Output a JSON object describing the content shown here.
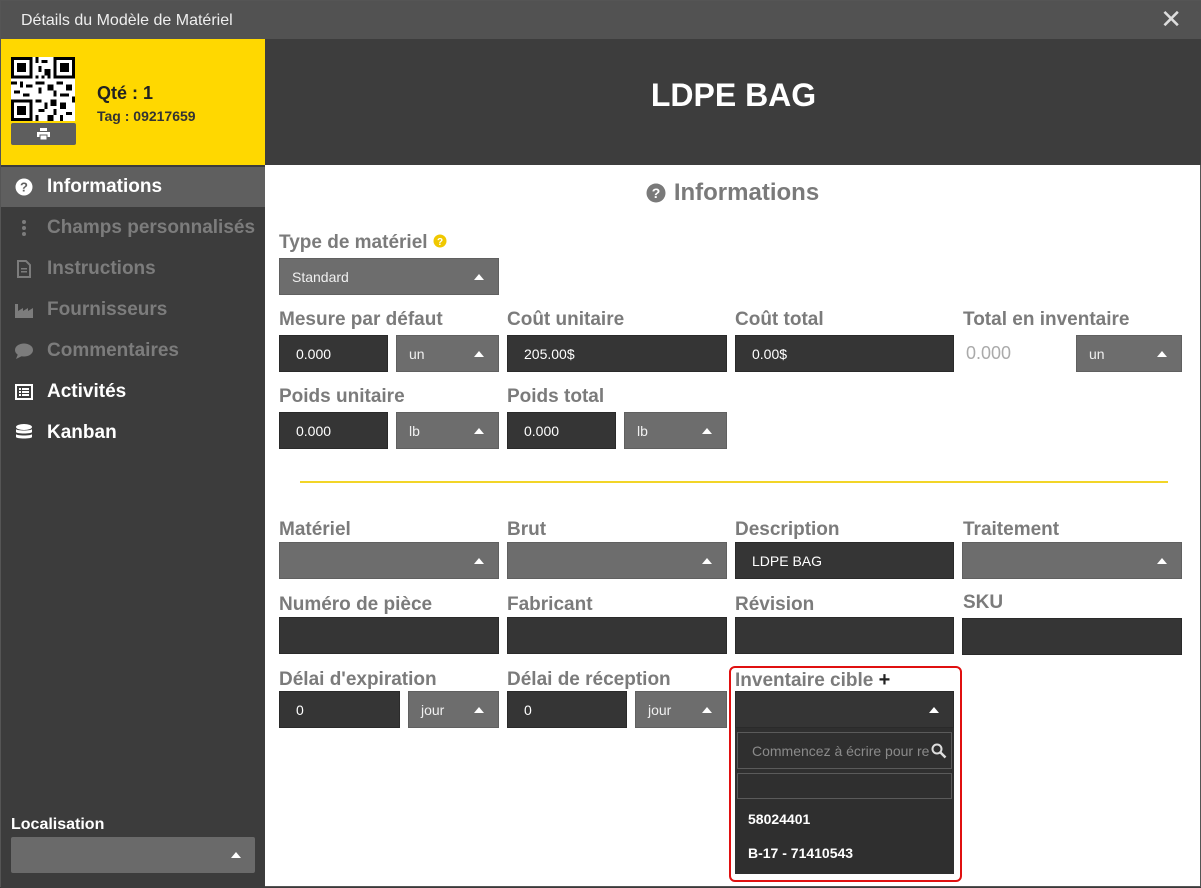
{
  "window": {
    "title": "Détails du Modèle de Matériel",
    "close_label": "✕"
  },
  "item": {
    "qty_text": "Qté : 1",
    "tag_text": "Tag : 09217659",
    "name": "LDPE BAG"
  },
  "sidebar": {
    "items": [
      {
        "label": "Informations",
        "icon": "question-circle-icon"
      },
      {
        "label": "Champs personnalisés",
        "icon": "vertical-ellipsis-icon"
      },
      {
        "label": "Instructions",
        "icon": "document-icon"
      },
      {
        "label": "Fournisseurs",
        "icon": "factory-icon"
      },
      {
        "label": "Commentaires",
        "icon": "comment-icon"
      },
      {
        "label": "Activités",
        "icon": "list-icon"
      },
      {
        "label": "Kanban",
        "icon": "database-icon"
      }
    ],
    "location_label": "Localisation",
    "location_value": ""
  },
  "section": {
    "title": "Informations"
  },
  "fields": {
    "material_type": {
      "label": "Type de matériel",
      "value": "Standard"
    },
    "default_measure": {
      "label": "Mesure par défaut",
      "value": "0.000",
      "unit": "un"
    },
    "unit_cost": {
      "label": "Coût unitaire",
      "value": "205.00$"
    },
    "total_cost": {
      "label": "Coût total",
      "value": "0.00$"
    },
    "total_inventory": {
      "label": "Total en inventaire",
      "value": "0.000",
      "unit": "un"
    },
    "unit_weight": {
      "label": "Poids unitaire",
      "value": "0.000",
      "unit": "lb"
    },
    "total_weight": {
      "label": "Poids total",
      "value": "0.000",
      "unit": "lb"
    },
    "material": {
      "label": "Matériel",
      "value": ""
    },
    "raw": {
      "label": "Brut",
      "value": ""
    },
    "description": {
      "label": "Description",
      "value": "LDPE BAG"
    },
    "treatment": {
      "label": "Traitement",
      "value": ""
    },
    "part_number": {
      "label": "Numéro de pièce",
      "value": ""
    },
    "manufacturer": {
      "label": "Fabricant",
      "value": ""
    },
    "revision": {
      "label": "Révision",
      "value": ""
    },
    "sku": {
      "label": "SKU",
      "value": ""
    },
    "expiry_delay": {
      "label": "Délai d'expiration",
      "value": "0",
      "unit": "jour"
    },
    "reception_delay": {
      "label": "Délai de réception",
      "value": "0",
      "unit": "jour"
    },
    "target_inventory": {
      "label": "Inventaire cible",
      "add_label": "+",
      "search_placeholder": "Commencez à écrire pour re",
      "options": [
        "58024401",
        "B-17 - 71410543"
      ]
    }
  },
  "colors": {
    "accent": "#ffd800",
    "highlight": "#e01010"
  }
}
